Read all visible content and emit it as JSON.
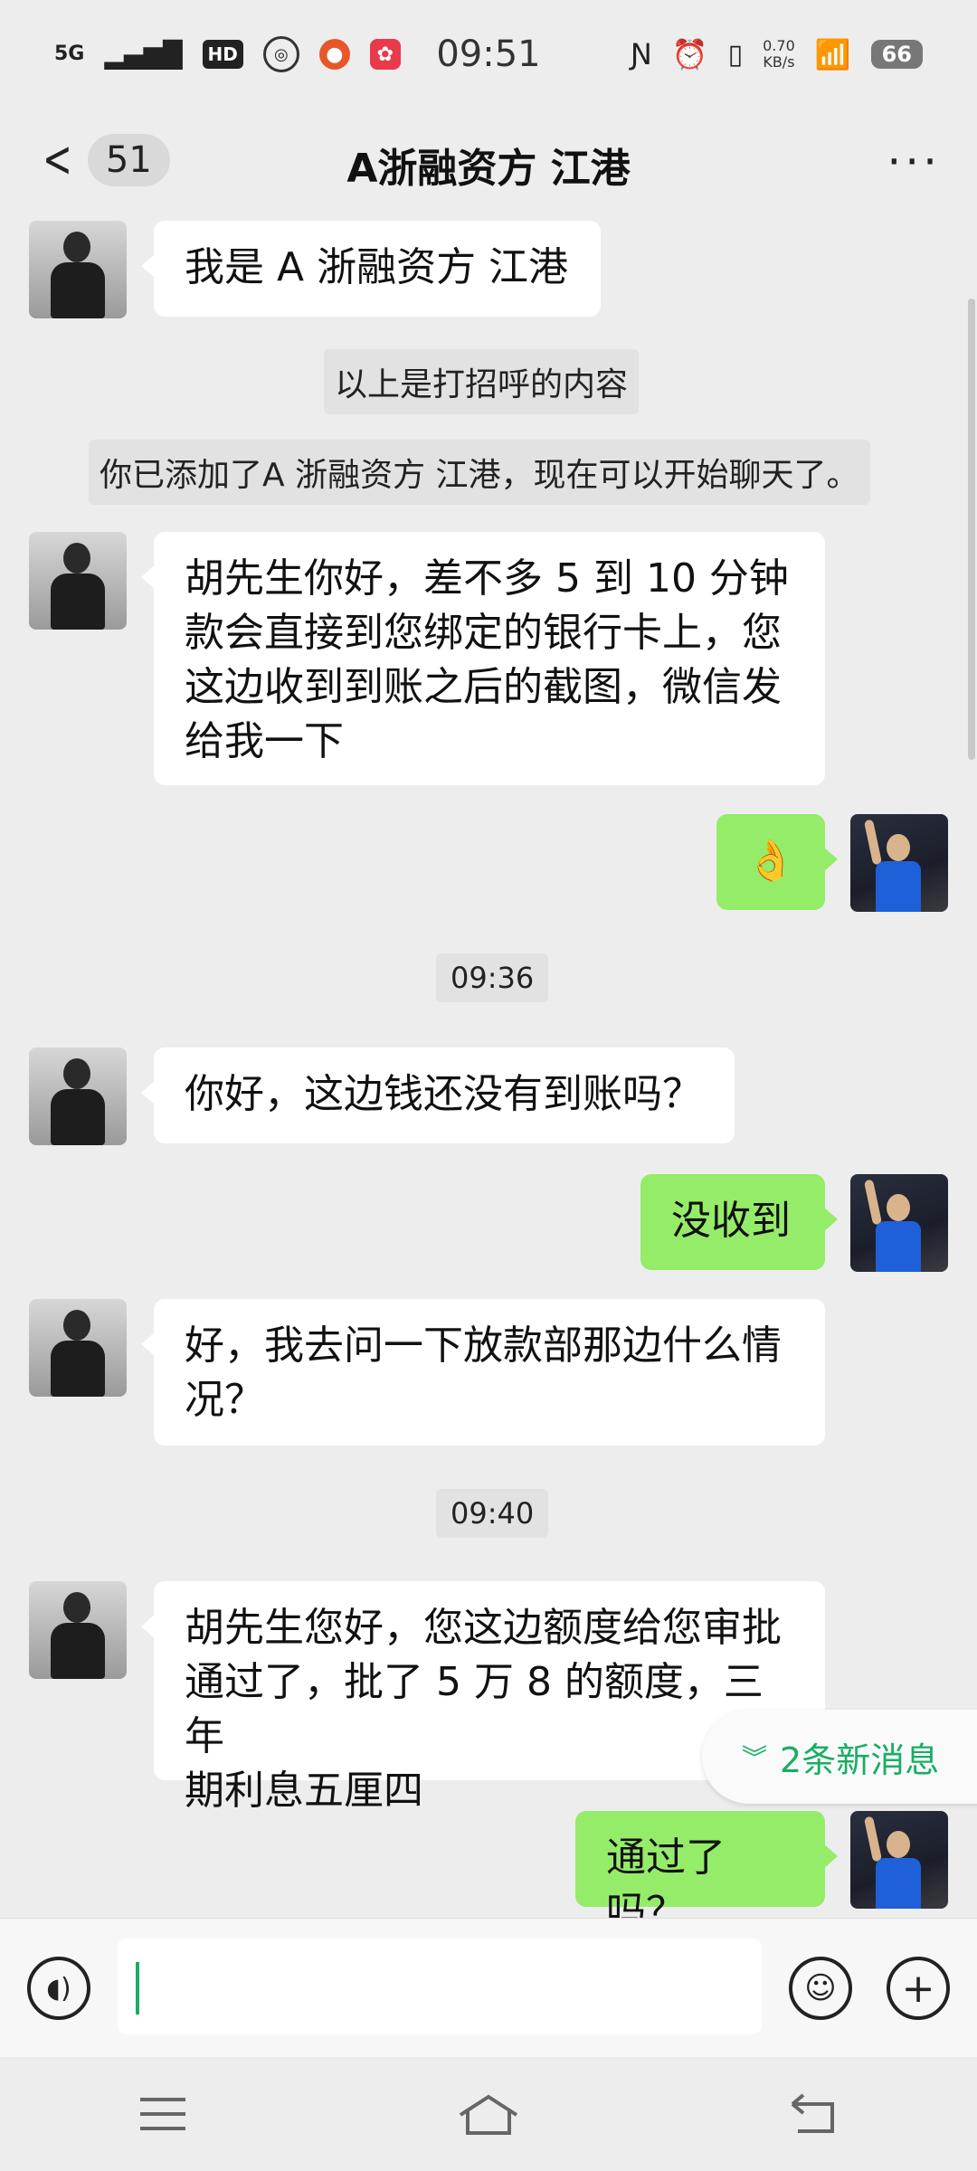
{
  "status_bar": {
    "network": "5G",
    "hd": "HD",
    "time": "09:51",
    "net_speed_value": "0.70",
    "net_speed_unit": "KB/s",
    "battery": "66"
  },
  "header": {
    "back_count": "51",
    "title": "A浙融资方 江港",
    "more": "···"
  },
  "messages": [
    {
      "type": "other",
      "text": "我是 A 浙融资方 江港"
    },
    {
      "type": "system",
      "text": "以上是打招呼的内容"
    },
    {
      "type": "system",
      "text": "你已添加了A 浙融资方 江港，现在可以开始聊天了。"
    },
    {
      "type": "other",
      "lines": [
        "胡先生你好，差不多 5 到 10 分钟",
        "款会直接到您绑定的银行卡上，您",
        "这边收到到账之后的截图，微信发",
        "给我一下"
      ]
    },
    {
      "type": "me",
      "text": "👌"
    },
    {
      "type": "time",
      "text": "09:36"
    },
    {
      "type": "other",
      "text": "你好，这边钱还没有到账吗？"
    },
    {
      "type": "me",
      "text": "没收到"
    },
    {
      "type": "other",
      "lines": [
        "好，我去问一下放款部那边什么情",
        "况？"
      ]
    },
    {
      "type": "time",
      "text": "09:40"
    },
    {
      "type": "other",
      "lines": [
        "胡先生您好，您这边额度给您审批",
        "通过了，批了 5 万 8 的额度，三年",
        "期利息五厘四"
      ]
    },
    {
      "type": "me",
      "text": "通过了吗？"
    }
  ],
  "new_messages_pill": "2条新消息",
  "input": {
    "voice_icon": "voice-icon",
    "emoji_icon": "emoji-icon",
    "plus_icon": "plus-icon"
  }
}
